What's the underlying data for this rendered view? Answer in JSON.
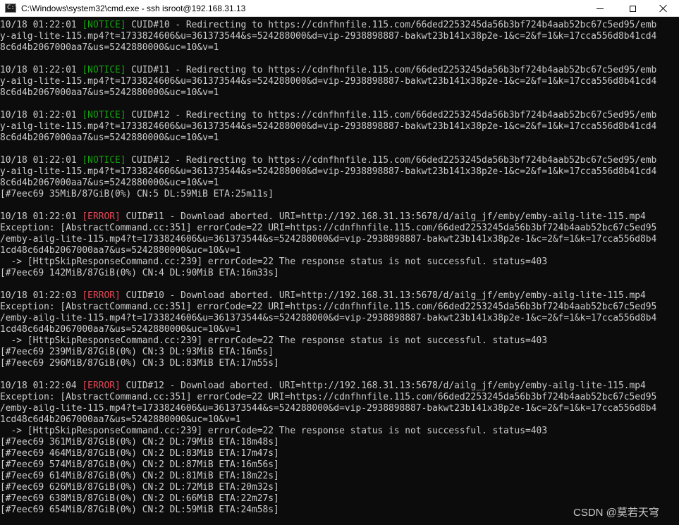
{
  "window": {
    "title": "C:\\Windows\\system32\\cmd.exe - ssh  isroot@192.168.31.13",
    "app_icon": "console-icon",
    "icon_prompt": "C:\\",
    "controls": [
      "minimize-icon",
      "maximize-icon",
      "close-icon"
    ]
  },
  "colors": {
    "notice": "#13a10e",
    "error": "#e74856",
    "text": "#cccccc",
    "background": "#0c0c0c"
  },
  "console": {
    "lines": [
      {
        "pre": "10/18 01:22:01 ",
        "tag": "[NOTICE]",
        "tag_type": "notice",
        "post": " CUID#10 - Redirecting to https://cdnfhnfile.115.com/66ded2253245da56b3bf724b4aab52bc67c5ed95/emb"
      },
      {
        "pre": "y-ailg-lite-115.mp4?t=1733824606&u=361373544&s=524288000&d=vip-2938898887-bakwt23b141x38p2e-1&c=2&f=1&k=17cca556d8b41cd4"
      },
      {
        "pre": "8c6d4b2067000aa7&us=5242880000&uc=10&v=1"
      },
      {
        "pre": ""
      },
      {
        "pre": "10/18 01:22:01 ",
        "tag": "[NOTICE]",
        "tag_type": "notice",
        "post": " CUID#11 - Redirecting to https://cdnfhnfile.115.com/66ded2253245da56b3bf724b4aab52bc67c5ed95/emb"
      },
      {
        "pre": "y-ailg-lite-115.mp4?t=1733824606&u=361373544&s=524288000&d=vip-2938898887-bakwt23b141x38p2e-1&c=2&f=1&k=17cca556d8b41cd4"
      },
      {
        "pre": "8c6d4b2067000aa7&us=5242880000&uc=10&v=1"
      },
      {
        "pre": ""
      },
      {
        "pre": "10/18 01:22:01 ",
        "tag": "[NOTICE]",
        "tag_type": "notice",
        "post": " CUID#12 - Redirecting to https://cdnfhnfile.115.com/66ded2253245da56b3bf724b4aab52bc67c5ed95/emb"
      },
      {
        "pre": "y-ailg-lite-115.mp4?t=1733824606&u=361373544&s=524288000&d=vip-2938898887-bakwt23b141x38p2e-1&c=2&f=1&k=17cca556d8b41cd4"
      },
      {
        "pre": "8c6d4b2067000aa7&us=5242880000&uc=10&v=1"
      },
      {
        "pre": ""
      },
      {
        "pre": "10/18 01:22:01 ",
        "tag": "[NOTICE]",
        "tag_type": "notice",
        "post": " CUID#12 - Redirecting to https://cdnfhnfile.115.com/66ded2253245da56b3bf724b4aab52bc67c5ed95/emb"
      },
      {
        "pre": "y-ailg-lite-115.mp4?t=1733824606&u=361373544&s=524288000&d=vip-2938898887-bakwt23b141x38p2e-1&c=2&f=1&k=17cca556d8b41cd4"
      },
      {
        "pre": "8c6d4b2067000aa7&us=5242880000&uc=10&v=1"
      },
      {
        "pre": "[#7eec69 35MiB/87GiB(0%) CN:5 DL:59MiB ETA:25m11s]"
      },
      {
        "pre": ""
      },
      {
        "pre": "10/18 01:22:01 ",
        "tag": "[ERROR]",
        "tag_type": "error",
        "post": " CUID#11 - Download aborted. URI=http://192.168.31.13:5678/d/ailg_jf/emby/emby-ailg-lite-115.mp4"
      },
      {
        "pre": "Exception: [AbstractCommand.cc:351] errorCode=22 URI=https://cdnfhnfile.115.com/66ded2253245da56b3bf724b4aab52bc67c5ed95"
      },
      {
        "pre": "/emby-ailg-lite-115.mp4?t=1733824606&u=361373544&s=524288000&d=vip-2938898887-bakwt23b141x38p2e-1&c=2&f=1&k=17cca556d8b4"
      },
      {
        "pre": "1cd48c6d4b2067000aa7&us=5242880000&uc=10&v=1"
      },
      {
        "pre": "  -> [HttpSkipResponseCommand.cc:239] errorCode=22 The response status is not successful. status=403"
      },
      {
        "pre": "[#7eec69 142MiB/87GiB(0%) CN:4 DL:90MiB ETA:16m33s]"
      },
      {
        "pre": ""
      },
      {
        "pre": "10/18 01:22:03 ",
        "tag": "[ERROR]",
        "tag_type": "error",
        "post": " CUID#10 - Download aborted. URI=http://192.168.31.13:5678/d/ailg_jf/emby/emby-ailg-lite-115.mp4"
      },
      {
        "pre": "Exception: [AbstractCommand.cc:351] errorCode=22 URI=https://cdnfhnfile.115.com/66ded2253245da56b3bf724b4aab52bc67c5ed95"
      },
      {
        "pre": "/emby-ailg-lite-115.mp4?t=1733824606&u=361373544&s=524288000&d=vip-2938898887-bakwt23b141x38p2e-1&c=2&f=1&k=17cca556d8b4"
      },
      {
        "pre": "1cd48c6d4b2067000aa7&us=5242880000&uc=10&v=1"
      },
      {
        "pre": "  -> [HttpSkipResponseCommand.cc:239] errorCode=22 The response status is not successful. status=403"
      },
      {
        "pre": "[#7eec69 239MiB/87GiB(0%) CN:3 DL:93MiB ETA:16m5s]"
      },
      {
        "pre": "[#7eec69 296MiB/87GiB(0%) CN:3 DL:83MiB ETA:17m55s]"
      },
      {
        "pre": ""
      },
      {
        "pre": "10/18 01:22:04 ",
        "tag": "[ERROR]",
        "tag_type": "error",
        "post": " CUID#12 - Download aborted. URI=http://192.168.31.13:5678/d/ailg_jf/emby/emby-ailg-lite-115.mp4"
      },
      {
        "pre": "Exception: [AbstractCommand.cc:351] errorCode=22 URI=https://cdnfhnfile.115.com/66ded2253245da56b3bf724b4aab52bc67c5ed95"
      },
      {
        "pre": "/emby-ailg-lite-115.mp4?t=1733824606&u=361373544&s=524288000&d=vip-2938898887-bakwt23b141x38p2e-1&c=2&f=1&k=17cca556d8b4"
      },
      {
        "pre": "1cd48c6d4b2067000aa7&us=5242880000&uc=10&v=1"
      },
      {
        "pre": "  -> [HttpSkipResponseCommand.cc:239] errorCode=22 The response status is not successful. status=403"
      },
      {
        "pre": "[#7eec69 361MiB/87GiB(0%) CN:2 DL:79MiB ETA:18m48s]"
      },
      {
        "pre": "[#7eec69 464MiB/87GiB(0%) CN:2 DL:83MiB ETA:17m47s]"
      },
      {
        "pre": "[#7eec69 574MiB/87GiB(0%) CN:2 DL:87MiB ETA:16m56s]"
      },
      {
        "pre": "[#7eec69 614MiB/87GiB(0%) CN:2 DL:81MiB ETA:18m22s]"
      },
      {
        "pre": "[#7eec69 626MiB/87GiB(0%) CN:2 DL:72MiB ETA:20m32s]"
      },
      {
        "pre": "[#7eec69 638MiB/87GiB(0%) CN:2 DL:66MiB ETA:22m27s]"
      },
      {
        "pre": "[#7eec69 654MiB/87GiB(0%) CN:2 DL:59MiB ETA:24m58s]"
      }
    ]
  },
  "watermark": "CSDN @莫若天穹"
}
